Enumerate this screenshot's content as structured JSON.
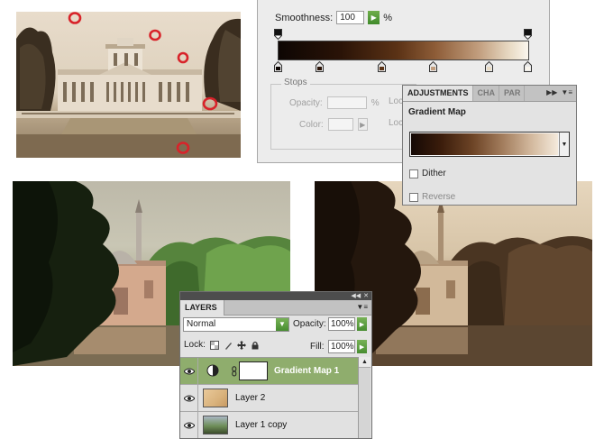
{
  "gradient_editor": {
    "smoothness_label": "Smoothness:",
    "smoothness_value": "100",
    "smoothness_unit": "%",
    "stops_legend": "Stops",
    "opacity_label": "Opacity:",
    "opacity_unit": "%",
    "color_label": "Color:",
    "location_label": "Loc"
  },
  "adjustments": {
    "tabs": [
      "ADJUSTMENTS",
      "CHA",
      "PAR"
    ],
    "title": "Gradient Map",
    "dither_label": "Dither",
    "reverse_label": "Reverse",
    "dither_checked": false,
    "reverse_checked": false
  },
  "layers": {
    "tab": "LAYERS",
    "blend_mode": "Normal",
    "opacity_label": "Opacity:",
    "opacity_value": "100%",
    "lock_label": "Lock:",
    "fill_label": "Fill:",
    "fill_value": "100%",
    "items": [
      {
        "name": "Gradient Map 1",
        "selected": true,
        "visible": true
      },
      {
        "name": "Layer 2",
        "selected": false,
        "visible": true
      },
      {
        "name": "Layer 1 copy",
        "selected": false,
        "visible": true
      }
    ]
  },
  "colors": {
    "selected_layer": "#8fad6d",
    "accent_green": "#478d30",
    "marker_red": "#d8232a"
  },
  "icons": {
    "panel_expand": "double-chevron-right",
    "panel_menu": "menu-lines",
    "close": "close-x",
    "visibility": "eye",
    "adjustment_layer": "half-circle",
    "chain": "link",
    "lock_transparent": "checker",
    "lock_image": "brush",
    "lock_position": "move-cross",
    "lock_all": "padlock"
  }
}
